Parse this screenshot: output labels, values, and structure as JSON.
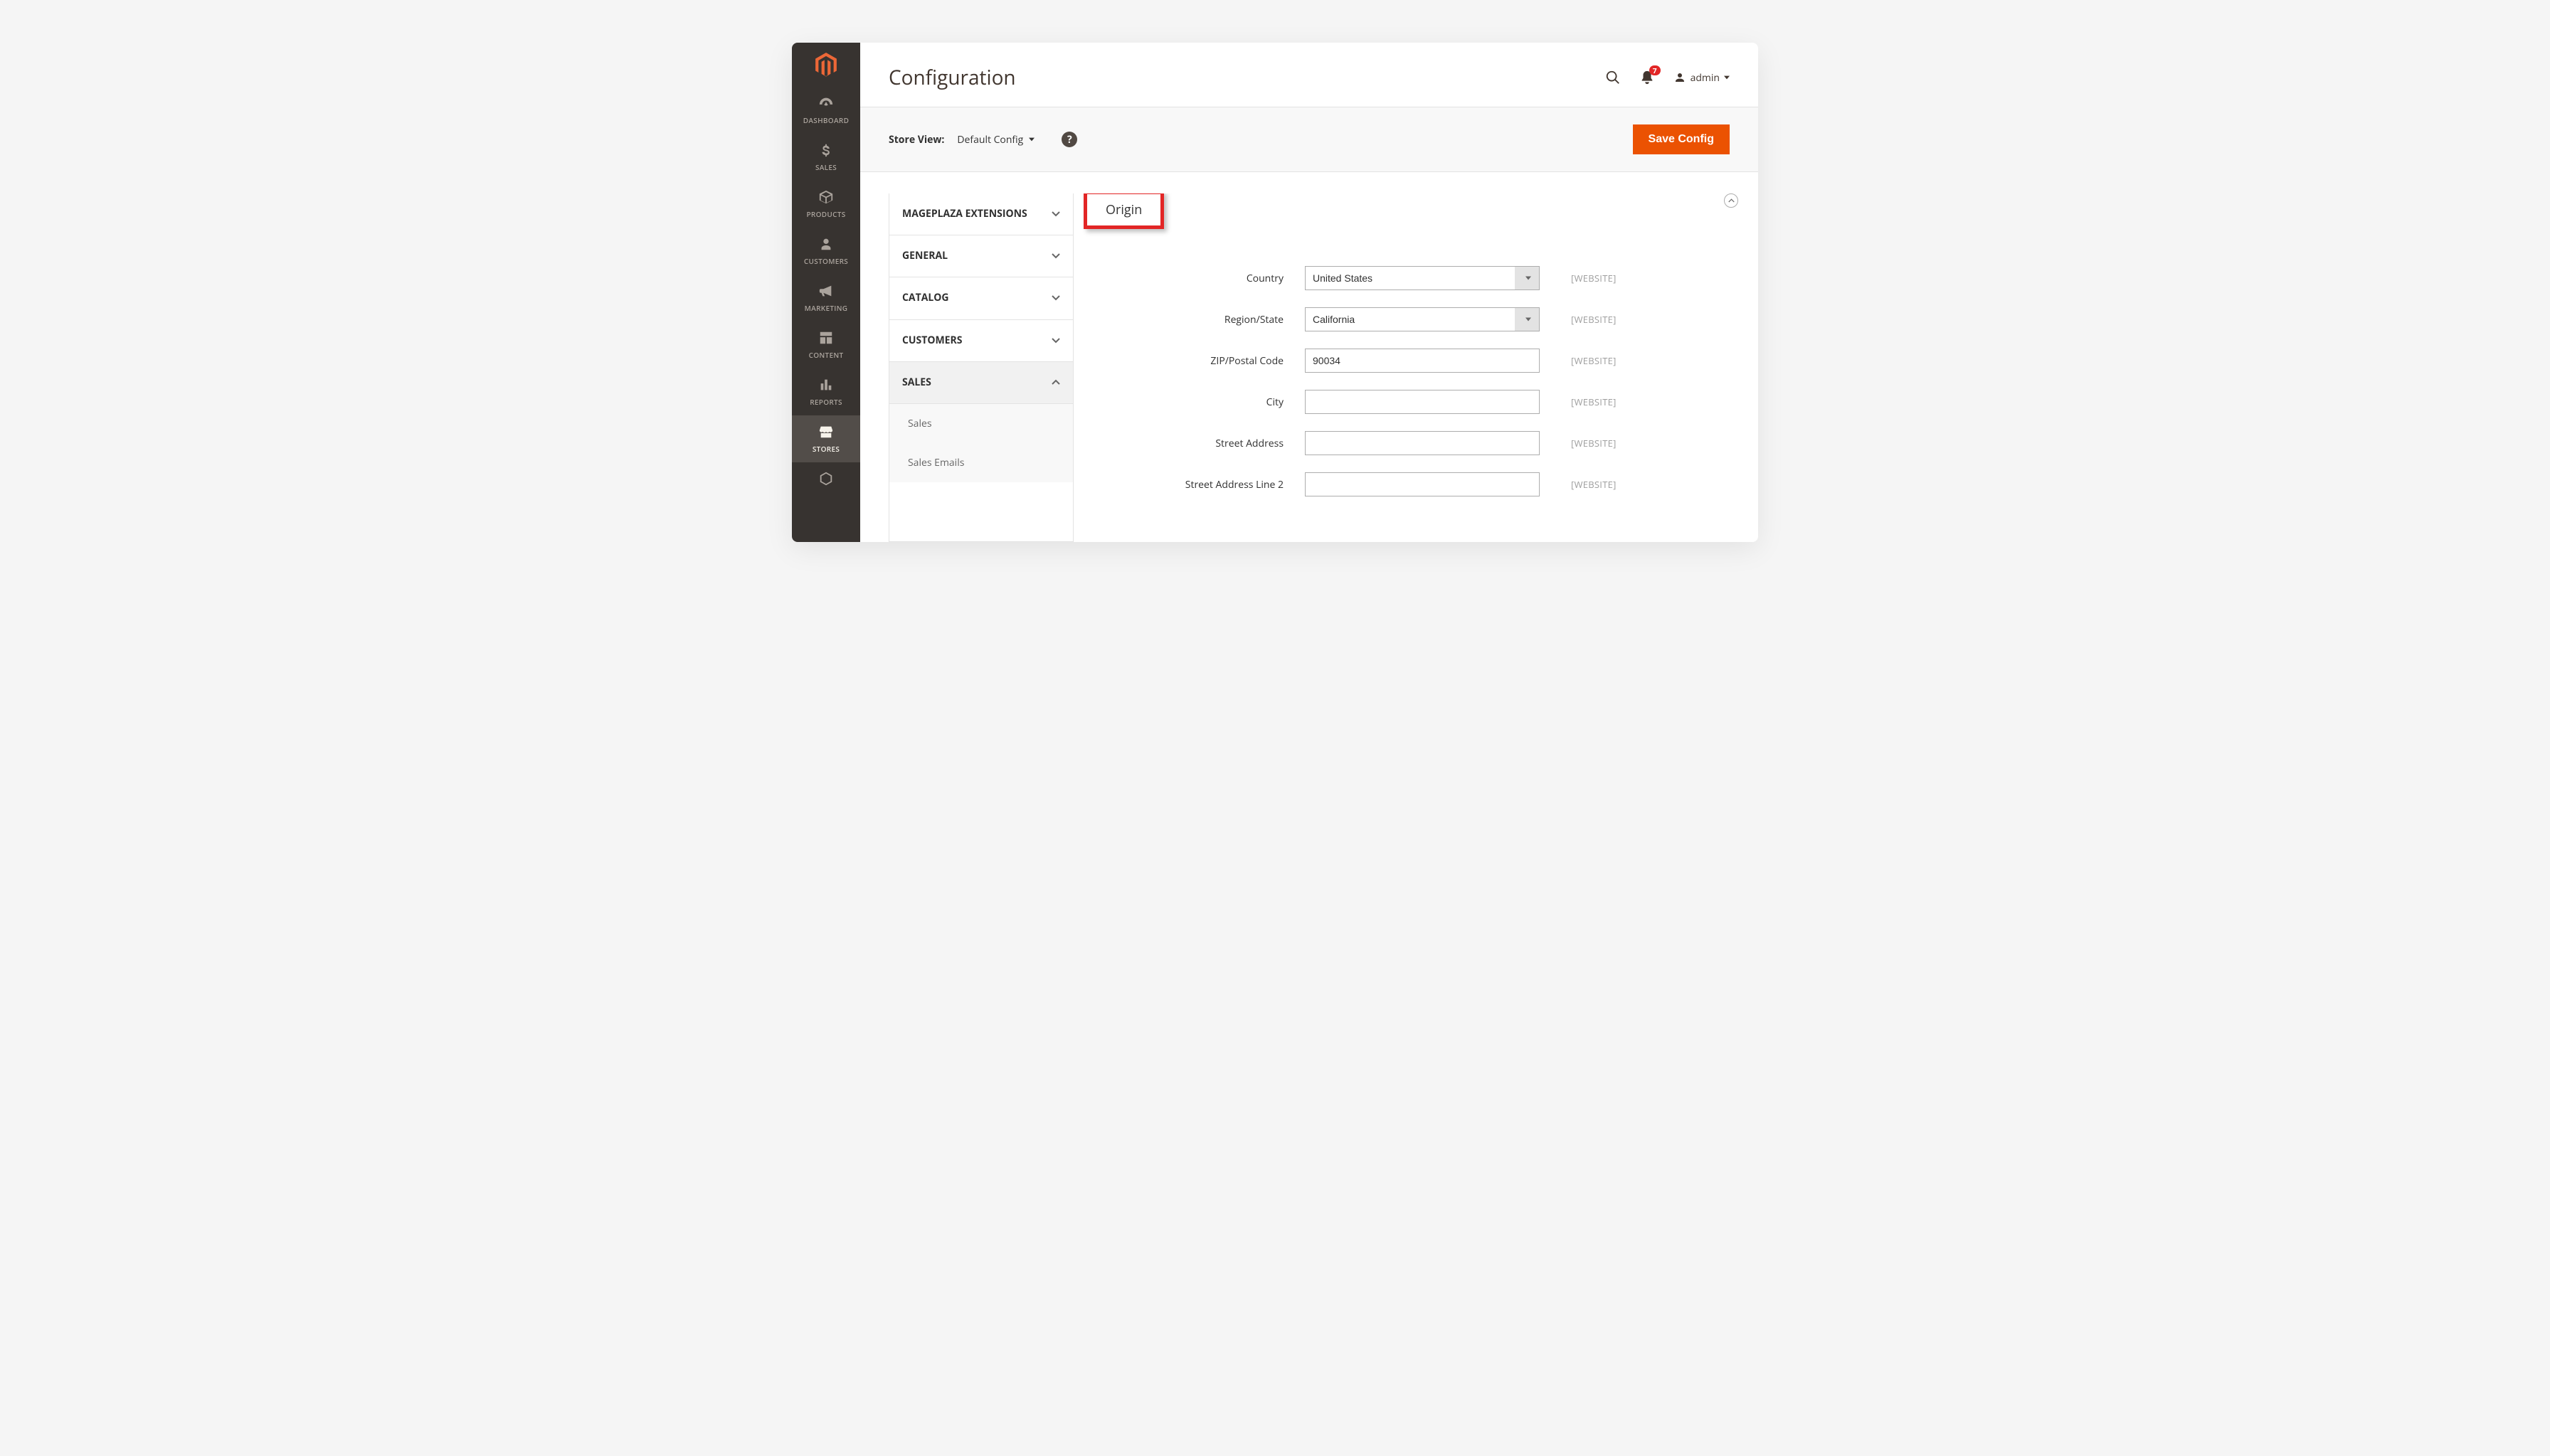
{
  "page": {
    "title": "Configuration"
  },
  "header": {
    "notification_count": "7",
    "user_name": "admin"
  },
  "toolbar": {
    "scope_label": "Store View:",
    "scope_value": "Default Config",
    "save_label": "Save Config"
  },
  "sidenav": {
    "items": [
      {
        "label": "DASHBOARD"
      },
      {
        "label": "SALES"
      },
      {
        "label": "PRODUCTS"
      },
      {
        "label": "CUSTOMERS"
      },
      {
        "label": "MARKETING"
      },
      {
        "label": "CONTENT"
      },
      {
        "label": "REPORTS"
      },
      {
        "label": "STORES"
      }
    ]
  },
  "config_tabs": {
    "groups": [
      {
        "label": "MAGEPLAZA EXTENSIONS",
        "expanded": false
      },
      {
        "label": "GENERAL",
        "expanded": false
      },
      {
        "label": "CATALOG",
        "expanded": false
      },
      {
        "label": "CUSTOMERS",
        "expanded": false
      },
      {
        "label": "SALES",
        "expanded": true,
        "items": [
          {
            "label": "Sales"
          },
          {
            "label": "Sales Emails"
          }
        ]
      }
    ]
  },
  "section": {
    "title": "Origin"
  },
  "scope_note": "[WEBSITE]",
  "fields": {
    "country": {
      "label": "Country",
      "value": "United States"
    },
    "region": {
      "label": "Region/State",
      "value": "California"
    },
    "zip": {
      "label": "ZIP/Postal Code",
      "value": "90034"
    },
    "city": {
      "label": "City",
      "value": ""
    },
    "street1": {
      "label": "Street Address",
      "value": ""
    },
    "street2": {
      "label": "Street Address Line 2",
      "value": ""
    }
  }
}
